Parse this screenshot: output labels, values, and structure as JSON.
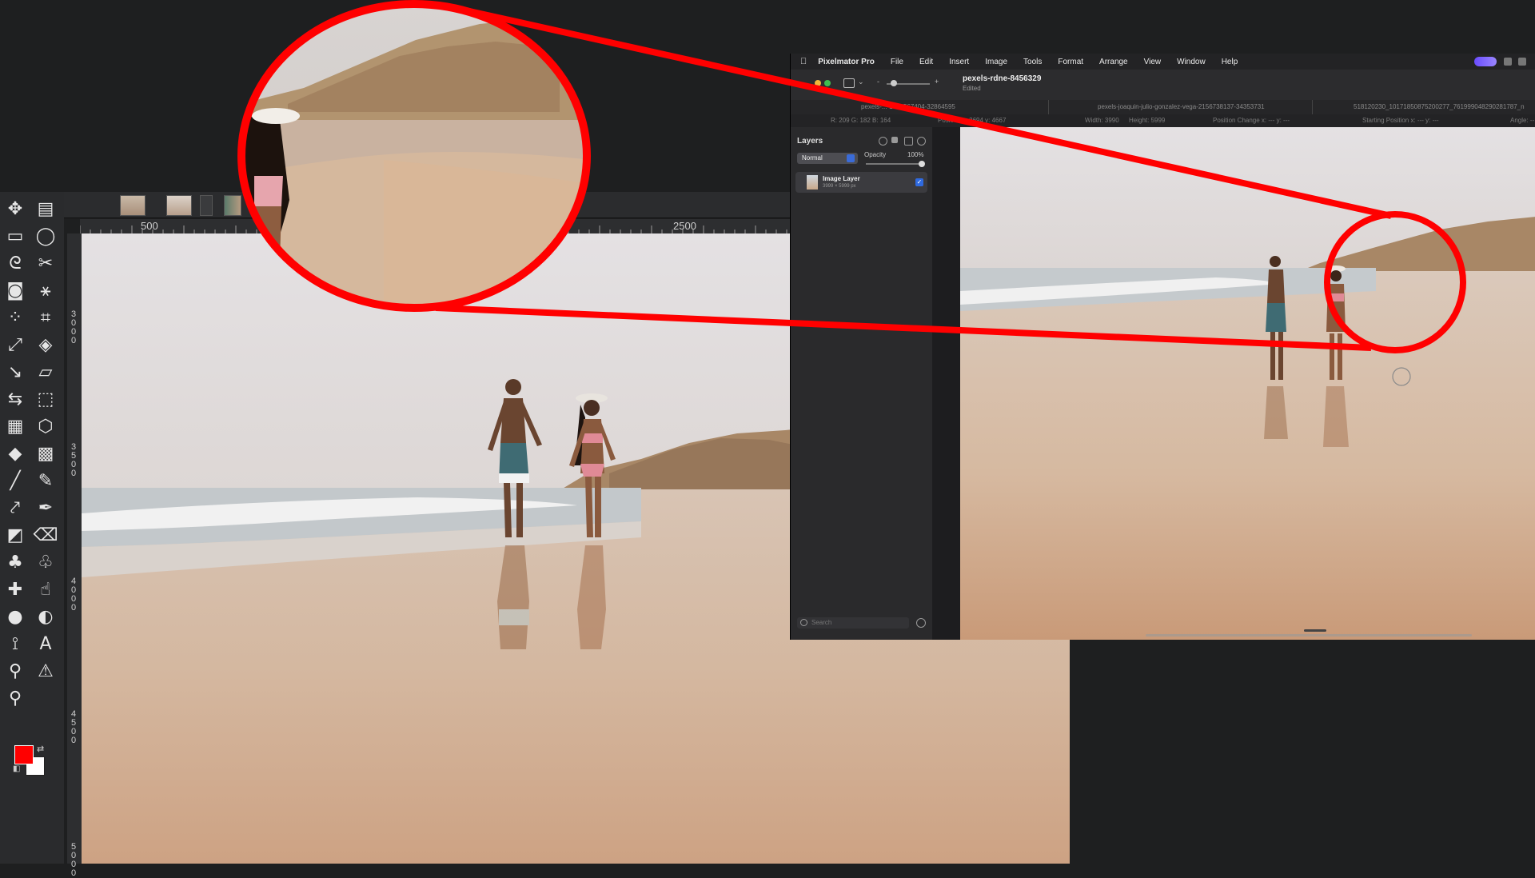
{
  "left_app": {
    "ruler": {
      "top_marks": [
        "500",
        "2500"
      ],
      "left_marks": [
        "3000",
        "3500",
        "4000",
        "4500",
        "5000"
      ]
    },
    "tools": [
      "move-icon",
      "align-icon",
      "rect-select-icon",
      "ellipse-select-icon",
      "lasso-icon",
      "scissors-icon",
      "foreground-select-icon",
      "fuzzy-select-icon",
      "by-color-select-icon",
      "crop-icon",
      "unified-transform-icon",
      "warp-transform-icon",
      "handle-transform-icon",
      "shear-icon",
      "flip-icon",
      "perspective-icon",
      "3d-transform-icon",
      "cage-transform-icon",
      "bucket-fill-icon",
      "gradient-icon",
      "paintbrush-icon",
      "pencil-icon",
      "airbrush-icon",
      "ink-icon",
      "mypaint-brush-icon",
      "eraser-icon",
      "clone-icon",
      "perspective-clone-icon",
      "heal-icon",
      "smudge-icon",
      "blur-icon",
      "dodge-burn-icon",
      "paths-icon",
      "text-icon",
      "color-picker-icon",
      "measure-icon",
      "zoom-icon"
    ],
    "colors": {
      "foreground": "#ff0000",
      "background": "#ffffff"
    }
  },
  "right_app": {
    "menu": [
      "Pixelmator Pro",
      "File",
      "Edit",
      "Insert",
      "Image",
      "Tools",
      "Format",
      "Arrange",
      "View",
      "Window",
      "Help"
    ],
    "document": {
      "title": "pexels-rdne-8456329",
      "subtitle": "Edited"
    },
    "tabs": [
      "pexels-...-1030567404-32864595",
      "pexels-joaquin-julio-gonzalez-vega-2156738137-34353731",
      "518120230_10171850875200277_761999048290281787_n"
    ],
    "info": {
      "rgb": "R: 209  G: 182  B: 164",
      "position": "Position x: 2694   y: 4667",
      "width": "Width: 3990",
      "height": "Height: 5999",
      "position_change": "Position Change x: ---   y: ---",
      "starting_position": "Starting Position x: ---   y: ---",
      "angle": "Angle: ---"
    },
    "layers_panel": {
      "title": "Layers",
      "blend_mode": "Normal",
      "opacity_label": "Opacity",
      "opacity_value": "100%",
      "layer_name": "Image Layer",
      "layer_size": "3999 × 5999 px",
      "search_placeholder": "Search"
    }
  },
  "annotation": {
    "color": "#ff0000"
  }
}
